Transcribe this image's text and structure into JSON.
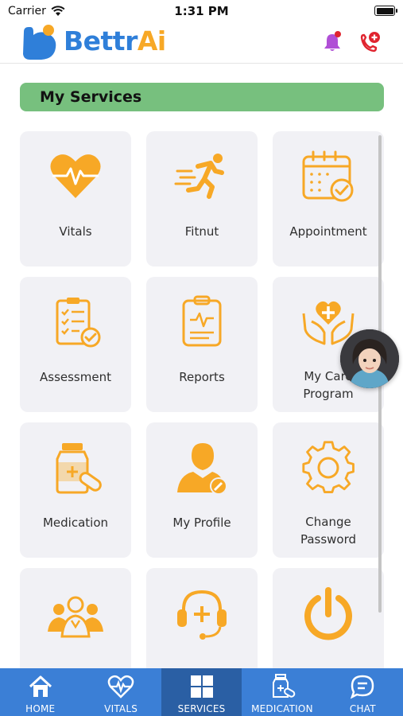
{
  "status_bar": {
    "carrier": "Carrier",
    "time": "1:31 PM"
  },
  "header": {
    "logo_part1": "Bettr",
    "logo_part2": "Ai",
    "brand_color": "#2f7fd9",
    "accent_color": "#f7a826",
    "icons": [
      "bell-icon",
      "phone-plus-icon"
    ]
  },
  "section": {
    "title": "My Services",
    "title_bg": "#77c07e"
  },
  "services": [
    {
      "label": "Vitals",
      "icon": "heart-pulse-icon"
    },
    {
      "label": "Fitnut",
      "icon": "runner-icon"
    },
    {
      "label": "Appointment",
      "icon": "calendar-check-icon"
    },
    {
      "label": "Assessment",
      "icon": "clipboard-checklist-icon"
    },
    {
      "label": "Reports",
      "icon": "clipboard-report-icon"
    },
    {
      "label": "My Care Program",
      "line1": "My Care",
      "line2": "Program",
      "icon": "hands-heart-icon"
    },
    {
      "label": "Medication",
      "icon": "medicine-bottle-icon"
    },
    {
      "label": "My Profile",
      "icon": "user-edit-icon"
    },
    {
      "label": "Change Password",
      "line1": "Change",
      "line2": "Password",
      "icon": "gear-icon"
    },
    {
      "label": "",
      "icon": "team-icon"
    },
    {
      "label": "",
      "icon": "headset-support-icon"
    },
    {
      "label": "",
      "icon": "power-icon"
    }
  ],
  "nav": {
    "items": [
      {
        "label": "HOME",
        "icon": "home-icon",
        "active": false
      },
      {
        "label": "VITALS",
        "icon": "heart-pulse-icon",
        "active": false
      },
      {
        "label": "SERVICES",
        "icon": "grid-icon",
        "active": true
      },
      {
        "label": "MEDICATION",
        "icon": "medicine-icon",
        "active": false
      },
      {
        "label": "CHAT",
        "icon": "chat-icon",
        "active": false
      }
    ],
    "bg_color": "#3b7fd6",
    "active_color": "#2a5fa4"
  }
}
